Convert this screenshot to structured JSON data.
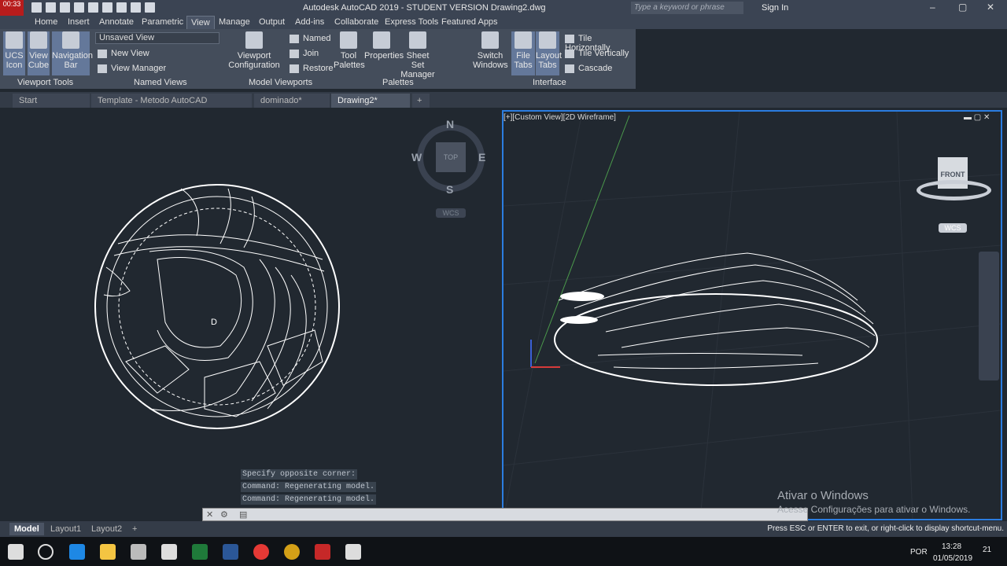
{
  "titlebar": {
    "recording_time": "00:33",
    "title": "Autodesk AutoCAD 2019 - STUDENT VERSION    Drawing2.dwg",
    "search_placeholder": "Type a keyword or phrase",
    "sign_in": "Sign In"
  },
  "menu": {
    "tabs": [
      "Home",
      "Insert",
      "Annotate",
      "Parametric",
      "View",
      "Manage",
      "Output",
      "Add-ins",
      "Collaborate",
      "Express Tools",
      "Featured Apps"
    ],
    "active": "View"
  },
  "ribbon": {
    "viewport_tools": {
      "title": "Viewport Tools",
      "ucs_icon": "UCS Icon",
      "view_cube": "View Cube",
      "navigation_bar": "Navigation Bar"
    },
    "named_views": {
      "title": "Named Views",
      "current_view": "Unsaved View",
      "new_view": "New View",
      "view_manager": "View Manager"
    },
    "model_viewports": {
      "title": "Model Viewports",
      "viewport_configuration": "Viewport Configuration",
      "named": "Named",
      "join": "Join",
      "restore": "Restore"
    },
    "palettes": {
      "title": "Palettes",
      "tool_palettes": "Tool Palettes",
      "properties": "Properties",
      "sheet_set_manager": "Sheet Set Manager"
    },
    "interface": {
      "title": "Interface",
      "switch_windows": "Switch Windows",
      "file_tabs": "File Tabs",
      "layout_tabs": "Layout Tabs",
      "tile_horizontally": "Tile Horizontally",
      "tile_vertically": "Tile Vertically",
      "cascade": "Cascade"
    }
  },
  "doc_tabs": [
    {
      "label": "Start"
    },
    {
      "label": "Template - Metodo AutoCAD Dominado*"
    },
    {
      "label": "dominado*"
    },
    {
      "label": "Drawing2*"
    }
  ],
  "viewport_left": {
    "compass": {
      "n": "N",
      "s": "S",
      "e": "E",
      "w": "W",
      "top": "TOP"
    },
    "wcs": "WCS"
  },
  "viewport_right": {
    "label": "[+][Custom View][2D Wireframe]",
    "cube_face": "FRONT",
    "wcs": "WCS"
  },
  "command": {
    "history": [
      "Specify opposite corner:",
      "Command:  Regenerating model.",
      "Command:  Regenerating model."
    ]
  },
  "layout_tabs": [
    "Model",
    "Layout1",
    "Layout2"
  ],
  "status_message": "Press ESC or ENTER to exit, or right-click to display shortcut-menu.",
  "watermark": {
    "line1": "Ativar o Windows",
    "line2": "Acesse Configurações para ativar o Windows."
  },
  "system_tray": {
    "language": "POR",
    "time": "13:28",
    "date": "01/05/2019",
    "notifications": "21"
  }
}
